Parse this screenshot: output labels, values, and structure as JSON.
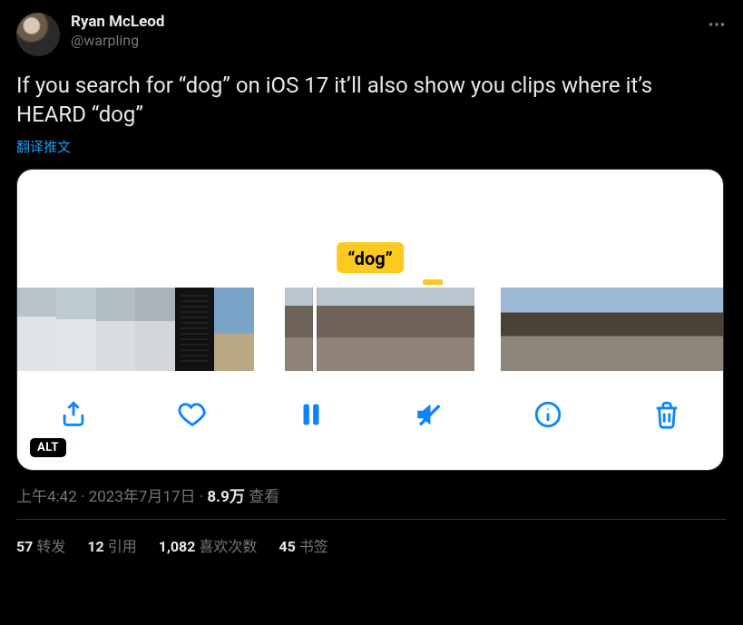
{
  "author": {
    "display_name": "Ryan McLeod",
    "handle": "@warpling"
  },
  "body_text": "If you search for “dog” on iOS 17 it’ll also show you clips where it’s HEARD “dog”",
  "translate_label": "翻译推文",
  "media": {
    "alt_badge": "ALT",
    "dog_chip": "“dog”"
  },
  "meta": {
    "time": "上午4:42",
    "sep1": " · ",
    "date": "2023年7月17日",
    "sep2": " · ",
    "views_number": "8.9万",
    "views_label": " 查看"
  },
  "stats": {
    "retweets": {
      "num": "57",
      "label": "转发"
    },
    "quotes": {
      "num": "12",
      "label": "引用"
    },
    "likes": {
      "num": "1,082",
      "label": "喜欢次数"
    },
    "bookmarks": {
      "num": "45",
      "label": "书签"
    }
  }
}
